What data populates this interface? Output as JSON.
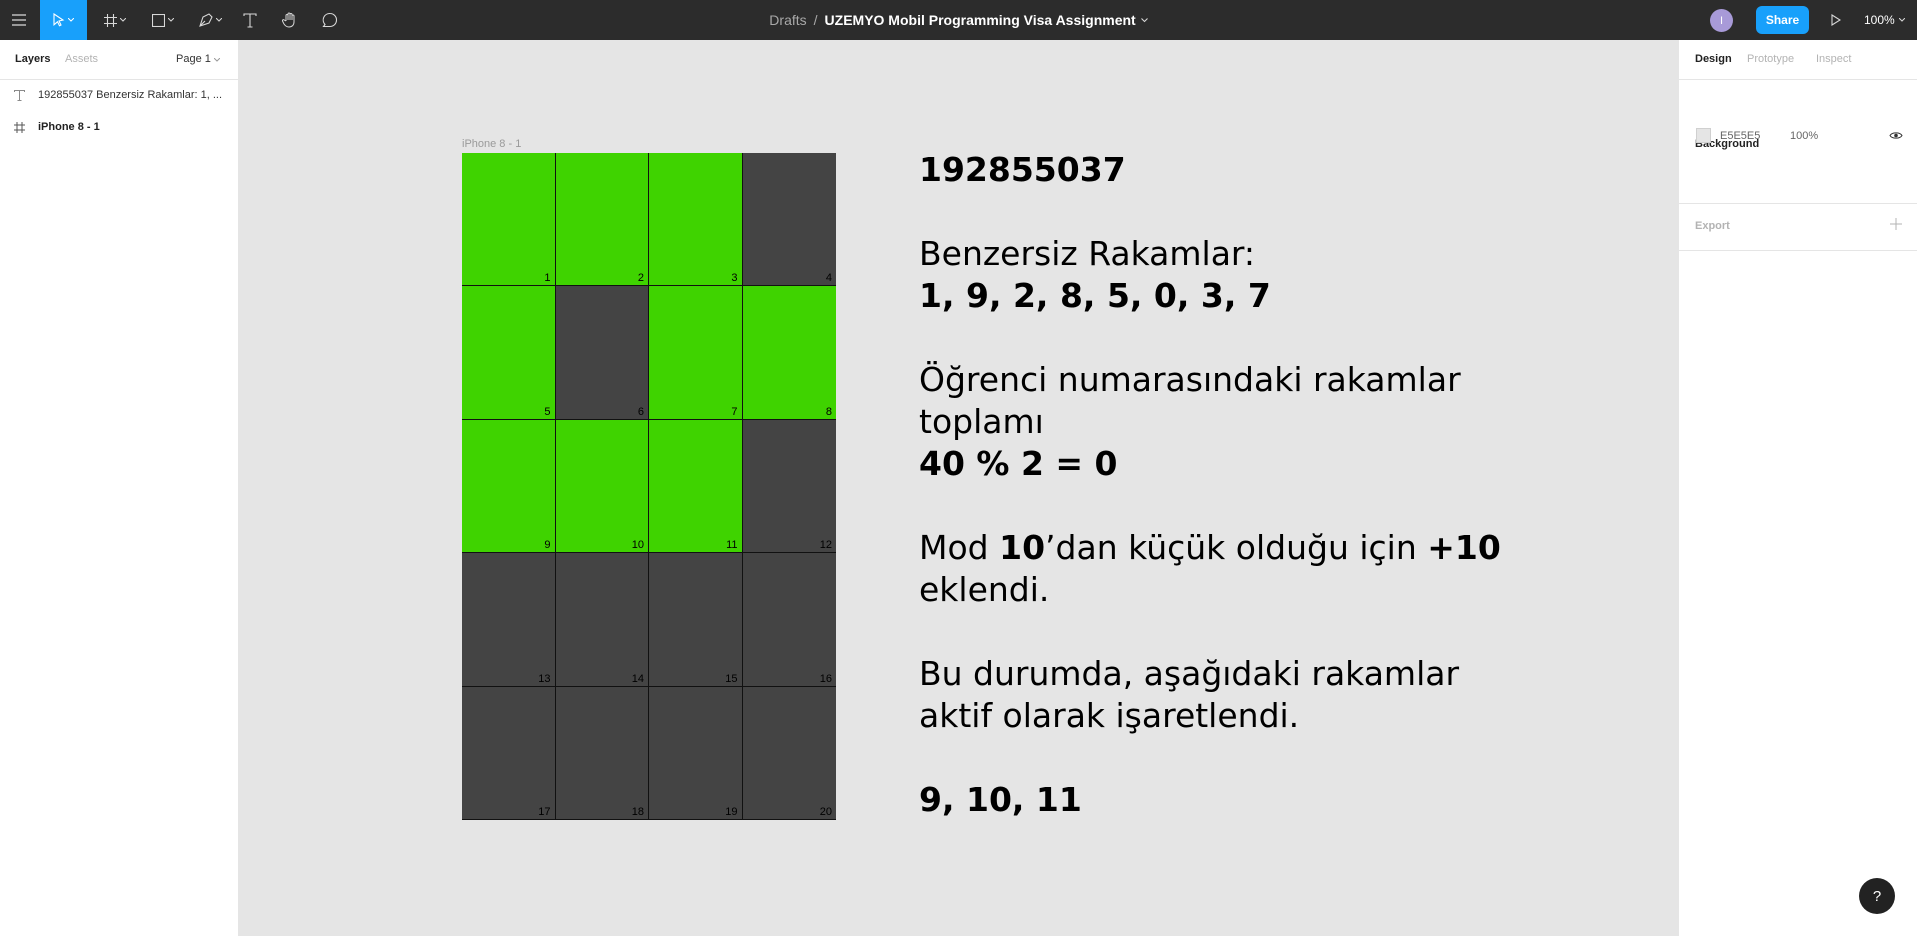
{
  "toolbar": {
    "breadcrumb_root": "Drafts",
    "separator": "/",
    "file_title": "UZEMYO Mobil Programming Visa Assignment",
    "avatar_initial": "I",
    "share_label": "Share",
    "zoom": "100%",
    "tools": [
      "menu-icon",
      "move-tool-icon",
      "frame-tool-icon",
      "shape-tool-icon",
      "pen-tool-icon",
      "text-tool-icon",
      "hand-tool-icon",
      "comment-tool-icon"
    ]
  },
  "left_panel": {
    "tabs": [
      "Layers",
      "Assets"
    ],
    "page": "Page 1",
    "layers": [
      {
        "icon": "text-layer-icon",
        "label": "192855037 Benzersiz Rakamlar: 1, ..."
      },
      {
        "icon": "frame-layer-icon",
        "label": "iPhone 8 - 1"
      }
    ]
  },
  "right_panel": {
    "tabs": [
      "Design",
      "Prototype",
      "Inspect"
    ],
    "background_label": "Background",
    "background_hex": "E5E5E5",
    "background_opacity": "100%",
    "export_label": "Export"
  },
  "canvas": {
    "frame_label": "iPhone 8 - 1",
    "grid": {
      "columns": 4,
      "cells": [
        {
          "n": "1",
          "active": true
        },
        {
          "n": "2",
          "active": true
        },
        {
          "n": "3",
          "active": true
        },
        {
          "n": "4",
          "active": false
        },
        {
          "n": "5",
          "active": true
        },
        {
          "n": "6",
          "active": false
        },
        {
          "n": "7",
          "active": true
        },
        {
          "n": "8",
          "active": true
        },
        {
          "n": "9",
          "active": true
        },
        {
          "n": "10",
          "active": true
        },
        {
          "n": "11",
          "active": true
        },
        {
          "n": "12",
          "active": false
        },
        {
          "n": "13",
          "active": false
        },
        {
          "n": "14",
          "active": false
        },
        {
          "n": "15",
          "active": false
        },
        {
          "n": "16",
          "active": false
        },
        {
          "n": "17",
          "active": false
        },
        {
          "n": "18",
          "active": false
        },
        {
          "n": "19",
          "active": false
        },
        {
          "n": "20",
          "active": false
        }
      ],
      "active_color": "#3fd300",
      "inactive_color": "#444444"
    },
    "text": {
      "student_no": "192855037",
      "unique_label": "Benzersiz Rakamlar:",
      "unique_digits": "1, 9, 2, 8, 5, 0, 3, 7",
      "sum_label_1": "Öğrenci numarasındaki rakamlar",
      "sum_label_2": "toplamı",
      "mod_result": "40 % 2 = 0",
      "mod_pre": "Mod ",
      "mod_num": "10",
      "mod_mid": "’dan küçük olduğu için ",
      "mod_add": "+10",
      "mod_end": "eklendi.",
      "marked_1": "Bu durumda, aşağıdaki rakamlar",
      "marked_2": "aktif olarak işaretlendi.",
      "marked_digits": "9, 10, 11"
    }
  },
  "help_label": "?"
}
